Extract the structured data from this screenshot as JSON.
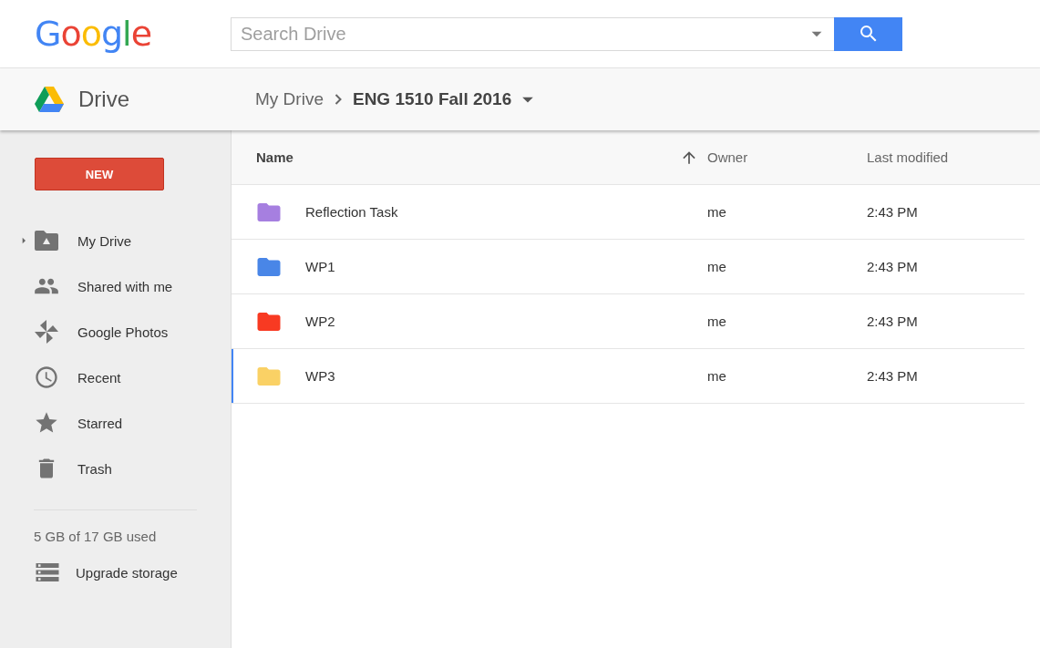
{
  "header": {
    "logo": "Google",
    "search": {
      "placeholder": "Search Drive"
    }
  },
  "subheader": {
    "app_name": "Drive",
    "breadcrumb": [
      {
        "label": "My Drive",
        "current": false
      },
      {
        "label": "ENG 1510 Fall 2016",
        "current": true
      }
    ]
  },
  "sidebar": {
    "new_button": "NEW",
    "items": [
      {
        "kind": "my-drive",
        "label": "My Drive",
        "expanded": false
      },
      {
        "kind": "shared",
        "label": "Shared with me"
      },
      {
        "kind": "photos",
        "label": "Google Photos"
      },
      {
        "kind": "recent",
        "label": "Recent"
      },
      {
        "kind": "starred",
        "label": "Starred"
      },
      {
        "kind": "trash",
        "label": "Trash"
      }
    ],
    "storage": "5 GB of 17 GB used",
    "upgrade": "Upgrade storage"
  },
  "table": {
    "columns": [
      "Name",
      "Owner",
      "Last modified"
    ],
    "rows": [
      {
        "name": "Reflection Task",
        "owner": "me",
        "modified": "2:43 PM",
        "color": "#a67fe0",
        "selected": false
      },
      {
        "name": "WP1",
        "owner": "me",
        "modified": "2:43 PM",
        "color": "#4986e7",
        "selected": false
      },
      {
        "name": "WP2",
        "owner": "me",
        "modified": "2:43 PM",
        "color": "#f83a22",
        "selected": false
      },
      {
        "name": "WP3",
        "owner": "me",
        "modified": "2:43 PM",
        "color": "#fad165",
        "selected": true
      }
    ]
  }
}
